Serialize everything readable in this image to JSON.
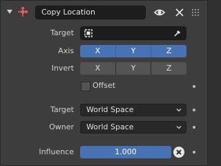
{
  "header": {
    "constraint_name": "Copy Location",
    "icons": [
      "chevron-down-icon",
      "copy-location-constraint-icon",
      "eye-icon",
      "close-icon",
      "drag-handle-icon"
    ]
  },
  "target": {
    "label": "Target"
  },
  "axis": {
    "label": "Axis",
    "buttons": [
      "X",
      "Y",
      "Z"
    ]
  },
  "invert": {
    "label": "Invert",
    "buttons": [
      "X",
      "Y",
      "Z"
    ]
  },
  "offset": {
    "label": "Offset",
    "checked": false
  },
  "target_space": {
    "label": "Target",
    "value": "World Space"
  },
  "owner_space": {
    "label": "Owner",
    "value": "World Space"
  },
  "influence": {
    "label": "Influence",
    "value": "1.000"
  },
  "colors": {
    "accent": "#4772b3",
    "icon_red": "#e06464",
    "panel": "#3d3d3d",
    "field": "#1d1d1d"
  }
}
